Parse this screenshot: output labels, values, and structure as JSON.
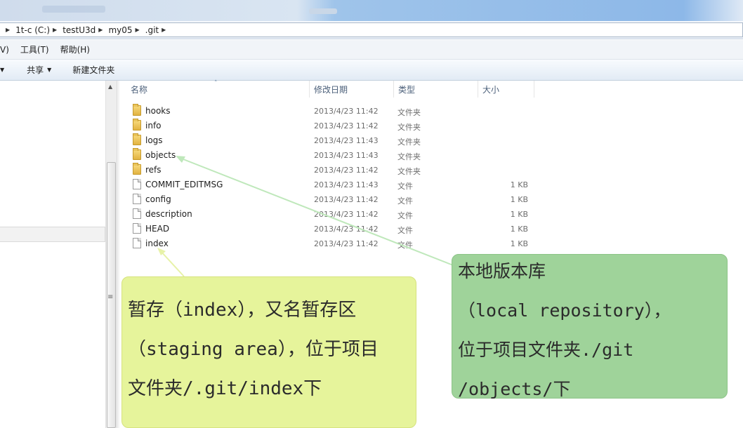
{
  "address": {
    "crumbs": [
      "1t-c (C:)",
      "testU3d",
      "my05",
      ".git"
    ]
  },
  "menu": {
    "items": [
      "V)",
      "工具(T)",
      "帮助(H)"
    ]
  },
  "toolbar": {
    "share_label": "共享",
    "new_folder_label": "新建文件夹"
  },
  "columns": {
    "name": "名称",
    "date": "修改日期",
    "type": "类型",
    "size": "大小"
  },
  "files": [
    {
      "name": "hooks",
      "date": "2013/4/23 11:42",
      "type": "文件夹",
      "size": "",
      "kind": "folder"
    },
    {
      "name": "info",
      "date": "2013/4/23 11:42",
      "type": "文件夹",
      "size": "",
      "kind": "folder"
    },
    {
      "name": "logs",
      "date": "2013/4/23 11:43",
      "type": "文件夹",
      "size": "",
      "kind": "folder"
    },
    {
      "name": "objects",
      "date": "2013/4/23 11:43",
      "type": "文件夹",
      "size": "",
      "kind": "folder"
    },
    {
      "name": "refs",
      "date": "2013/4/23 11:42",
      "type": "文件夹",
      "size": "",
      "kind": "folder"
    },
    {
      "name": "COMMIT_EDITMSG",
      "date": "2013/4/23 11:43",
      "type": "文件",
      "size": "1 KB",
      "kind": "file"
    },
    {
      "name": "config",
      "date": "2013/4/23 11:42",
      "type": "文件",
      "size": "1 KB",
      "kind": "file"
    },
    {
      "name": "description",
      "date": "2013/4/23 11:42",
      "type": "文件",
      "size": "1 KB",
      "kind": "file"
    },
    {
      "name": "HEAD",
      "date": "2013/4/23 11:42",
      "type": "文件",
      "size": "1 KB",
      "kind": "file"
    },
    {
      "name": "index",
      "date": "2013/4/23 11:42",
      "type": "文件",
      "size": "1 KB",
      "kind": "file"
    }
  ],
  "annotations": {
    "staging": {
      "lines": [
        "暂存（index），又名暂存区",
        "（staging area），位于项目",
        "文件夹/.git/index下"
      ],
      "color": "#e6f49b"
    },
    "repository": {
      "lines": [
        "本地版本库",
        "（local repository），",
        "位于项目文件夹./git",
        "/objects/下"
      ],
      "color": "#9fd39a"
    }
  }
}
